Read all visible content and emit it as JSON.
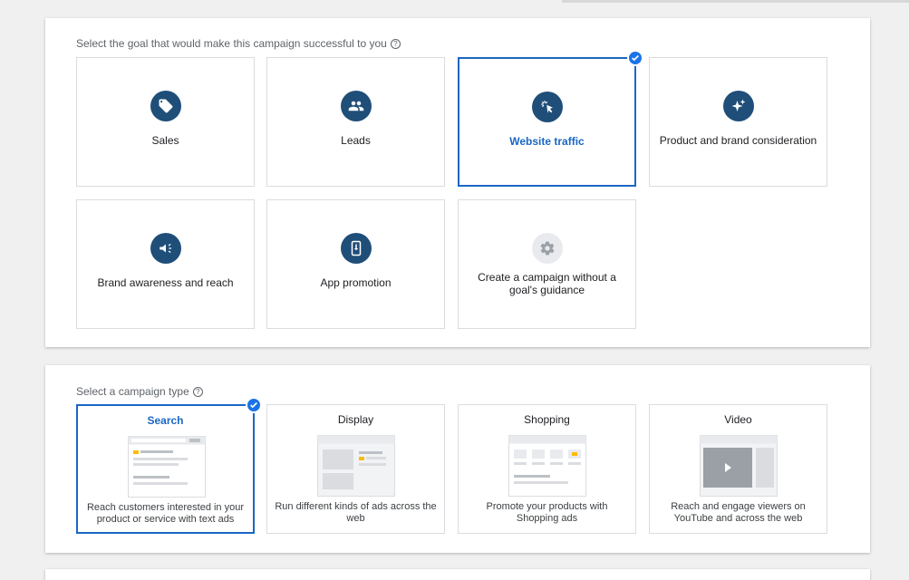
{
  "goal_section": {
    "label": "Select the goal that would make this campaign successful to you",
    "help_glyph": "?",
    "goals": [
      {
        "label": "Sales",
        "icon": "tag-icon",
        "selected": false
      },
      {
        "label": "Leads",
        "icon": "people-icon",
        "selected": false
      },
      {
        "label": "Website traffic",
        "icon": "cursor-click-icon",
        "selected": true
      },
      {
        "label": "Product and brand consideration",
        "icon": "sparkle-icon",
        "selected": false
      },
      {
        "label": "Brand awareness and reach",
        "icon": "megaphone-icon",
        "selected": false
      },
      {
        "label": "App promotion",
        "icon": "phone-download-icon",
        "selected": false
      },
      {
        "label": "Create a campaign without a goal's guidance",
        "icon": "gear-icon",
        "selected": false
      }
    ]
  },
  "type_section": {
    "label": "Select a campaign type",
    "help_glyph": "?",
    "types": [
      {
        "title": "Search",
        "desc": "Reach customers interested in your product or service with text ads",
        "illustration": "search-ad-illustration",
        "selected": true
      },
      {
        "title": "Display",
        "desc": "Run different kinds of ads across the web",
        "illustration": "display-ad-illustration",
        "selected": false
      },
      {
        "title": "Shopping",
        "desc": "Promote your products with Shopping ads",
        "illustration": "shopping-ad-illustration",
        "selected": false
      },
      {
        "title": "Video",
        "desc": "Reach and engage viewers on YouTube and across the web",
        "illustration": "video-ad-illustration",
        "selected": false
      }
    ]
  },
  "colors": {
    "accent": "#1a67c4",
    "icon_bg": "#1f4e79",
    "highlight": "#fbbc04"
  }
}
